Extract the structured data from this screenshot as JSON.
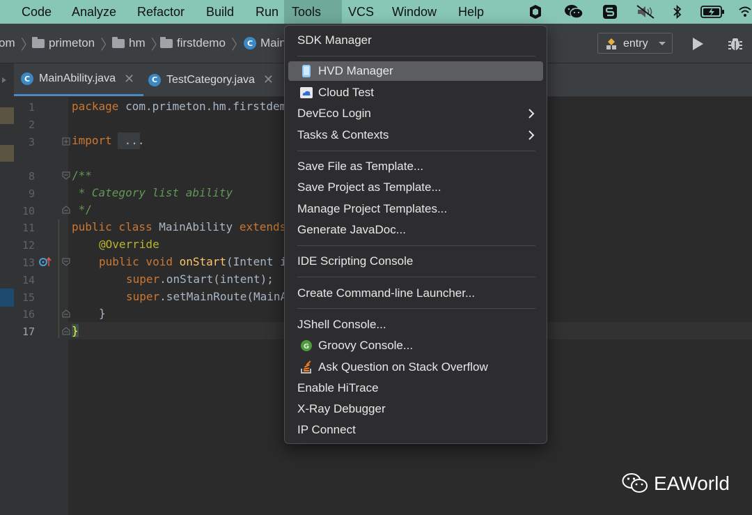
{
  "menubar": {
    "items": [
      "Code",
      "Analyze",
      "Refactor",
      "Build",
      "Run",
      "Tools",
      "VCS",
      "Window",
      "Help"
    ],
    "active": "Tools"
  },
  "navbar": {
    "breadcrumbs": [
      "om",
      "primeton",
      "hm",
      "firstdemo",
      "Main"
    ],
    "run_config": "entry"
  },
  "tabs": [
    {
      "label": "MainAbility.java",
      "active": true
    },
    {
      "label": "TestCategory.java",
      "active": false
    }
  ],
  "editor": {
    "line_numbers": [
      "1",
      "2",
      "3",
      "8",
      "9",
      "10",
      "11",
      "12",
      "13",
      "14",
      "15",
      "16",
      "17"
    ],
    "lines": {
      "l1_kw": "package",
      "l1_rest": " com.primeton.hm.firstdem",
      "l3_kw": "import",
      "l3_rest": " ...",
      "l8": "/**",
      "l9": " * Category list ability",
      "l10": " */",
      "l11_kw1": "public class",
      "l11_mid": " MainAbility ",
      "l11_kw2": "extends",
      "l12": "@Override",
      "l13_kw": "public void",
      "l13_fn": " onStart",
      "l13_rest": "(Intent i",
      "l14_kw": "super",
      "l14_rest": ".onStart(intent);",
      "l15_kw": "super",
      "l15_rest": ".setMainRoute(MainA",
      "l16": "}",
      "l17": "}"
    }
  },
  "tools_menu": {
    "items": [
      {
        "label": "SDK Manager"
      },
      {
        "label": "HVD Manager",
        "icon": "phone-icon",
        "highlighted": true
      },
      {
        "label": "Cloud Test",
        "icon": "cloud-icon"
      },
      {
        "label": "DevEco Login",
        "submenu": true
      },
      {
        "label": "Tasks & Contexts",
        "submenu": true
      },
      {
        "label": "Save File as Template..."
      },
      {
        "label": "Save Project as Template..."
      },
      {
        "label": "Manage Project Templates..."
      },
      {
        "label": "Generate JavaDoc..."
      },
      {
        "label": "IDE Scripting Console"
      },
      {
        "label": "Create Command-line Launcher..."
      },
      {
        "label": "JShell Console..."
      },
      {
        "label": "Groovy Console...",
        "icon": "groovy-icon"
      },
      {
        "label": "Ask Question on Stack Overflow",
        "icon": "stackoverflow-icon"
      },
      {
        "label": "Enable HiTrace"
      },
      {
        "label": "X-Ray Debugger"
      },
      {
        "label": "IP Connect"
      }
    ]
  },
  "watermark": {
    "text": "EAWorld"
  },
  "colors": {
    "menubar_bg": "#88c7b6",
    "menu_bg": "#2d2d2f",
    "highlight": "#5b5d60"
  }
}
